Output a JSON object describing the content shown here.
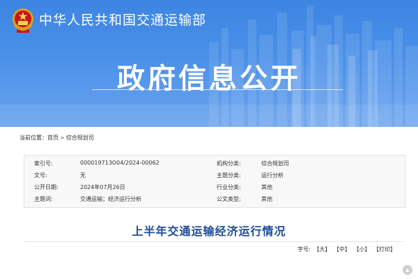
{
  "header": {
    "site_name": "中华人民共和国交通运输部",
    "banner_title": "政府信息公开",
    "icons": {
      "emblem": "national-emblem-icon"
    },
    "colors": {
      "banner_blue": "#4a90e8",
      "title_blue": "#1d4c99"
    }
  },
  "breadcrumb": {
    "label": "当前位置：",
    "items": [
      "首页",
      "综合规划司"
    ],
    "separator": ">"
  },
  "meta": {
    "rows": [
      {
        "label1": "索引号:",
        "value1": "000019713O04/2024-00062",
        "label2": "机构分类:",
        "value2": "综合规划司"
      },
      {
        "label1": "文号:",
        "value1": "无",
        "label2": "主题分类:",
        "value2": "运行分析"
      },
      {
        "label1": "公开日期:",
        "value1": "2024年07月26日",
        "label2": "行业分类:",
        "value2": "其他"
      },
      {
        "label1": "主题词:",
        "value1": "交通运输；经济运行分析",
        "label2": "公文类型:",
        "value2": "其他"
      }
    ]
  },
  "article": {
    "title": "上半年交通运输经济运行情况"
  },
  "font_size_bar": {
    "label": "字号:",
    "large": "【大】",
    "medium": "【中】",
    "small": "【小】",
    "print": "【打印】"
  }
}
